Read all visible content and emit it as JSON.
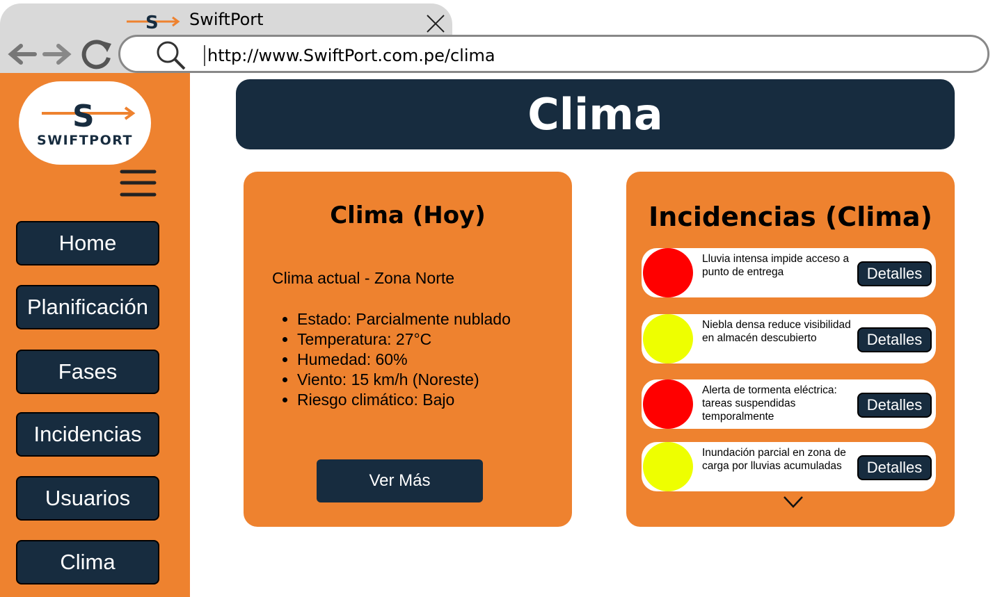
{
  "browser": {
    "tab_title": "SwiftPort",
    "url": "http://www.SwiftPort.com.pe/clima"
  },
  "sidebar": {
    "logo_text": "SWIFTPORT",
    "items": [
      {
        "label": "Home"
      },
      {
        "label": "Planificación"
      },
      {
        "label": "Fases"
      },
      {
        "label": "Incidencias"
      },
      {
        "label": "Usuarios"
      },
      {
        "label": "Clima"
      }
    ]
  },
  "header": {
    "title": "Clima"
  },
  "weather": {
    "title": "Clima (Hoy)",
    "zone": "Clima actual - Zona Norte",
    "details": [
      "Estado:  Parcialmente nublado",
      "Temperatura: 27°C",
      "Humedad: 60%",
      "Viento: 15 km/h (Noreste)",
      "Riesgo climático: Bajo"
    ],
    "button": "Ver Más"
  },
  "incidents": {
    "title": "Incidencias (Clima)",
    "button_label": "Detalles",
    "items": [
      {
        "text": "Lluvia intensa impide acceso a punto de entrega",
        "color": "#FF0000"
      },
      {
        "text": "Niebla densa reduce visibilidad en almacén descubierto",
        "color": "#EEFF00"
      },
      {
        "text": "Alerta de tormenta eléctrica: tareas suspendidas temporalmente",
        "color": "#FF0000"
      },
      {
        "text": "Inundación parcial en zona de carga por lluvias acumuladas",
        "color": "#EEFF00"
      }
    ]
  },
  "colors": {
    "accent": "#EE822F",
    "primary": "#172C3F"
  }
}
